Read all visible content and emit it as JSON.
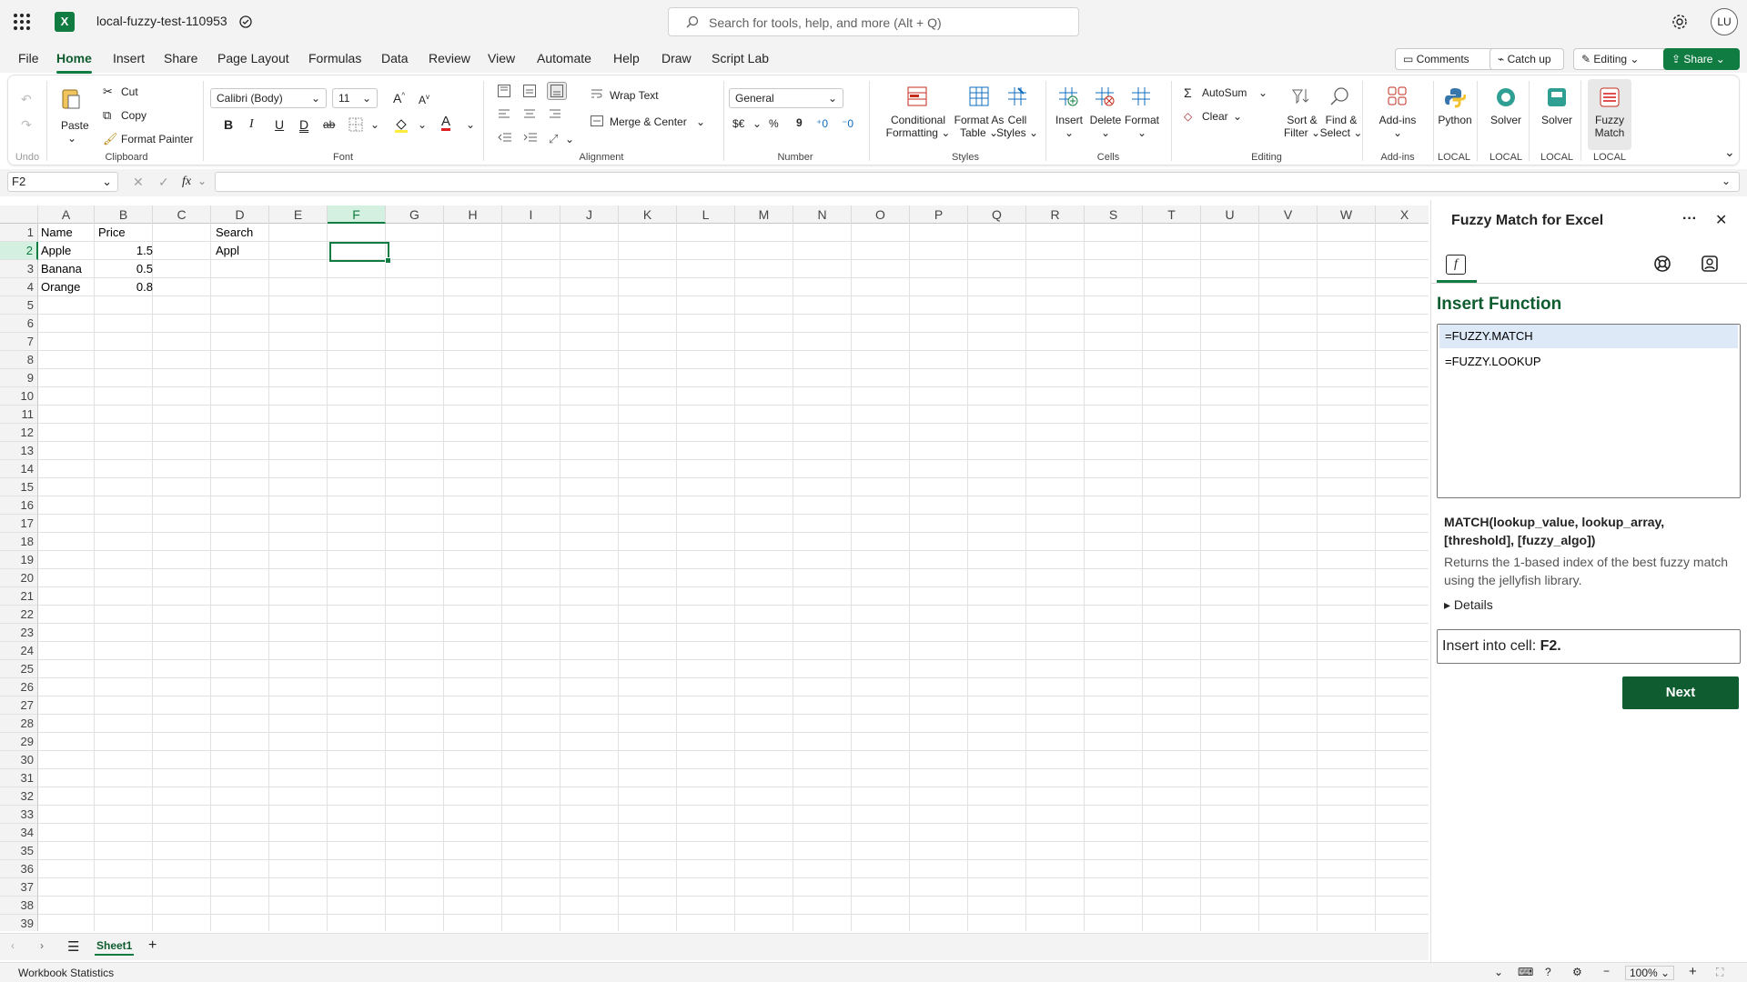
{
  "app": {
    "doc_name": "local-fuzzy-test-110953",
    "avatar_initials": "LU",
    "accent": "#107c41"
  },
  "search": {
    "placeholder": "Search for tools, help, and more (Alt + Q)"
  },
  "menu_tabs": [
    "File",
    "Home",
    "Insert",
    "Share",
    "Page Layout",
    "Formulas",
    "Data",
    "Review",
    "View",
    "Automate",
    "Help",
    "Draw",
    "Script Lab"
  ],
  "top_buttons": {
    "comments": "Comments",
    "catch_up": "Catch up",
    "editing": "Editing",
    "share": "Share"
  },
  "ribbon": {
    "undo_group": "Undo",
    "clipboard": {
      "paste": "Paste",
      "cut": "Cut",
      "copy": "Copy",
      "format_painter": "Format Painter",
      "group": "Clipboard"
    },
    "font": {
      "family": "Calibri (Body)",
      "size": "11",
      "group": "Font",
      "bold": "B",
      "italic": "I",
      "underline": "U",
      "dunderline": "D",
      "strike": "ab",
      "color_a": "A",
      "grow": "A",
      "shrink": "A"
    },
    "alignment": {
      "wrap": "Wrap Text",
      "merge": "Merge & Center",
      "group": "Alignment"
    },
    "number": {
      "format": "General",
      "currency": "$€",
      "percent": "%",
      "comma": "9",
      "group": "Number"
    },
    "styles": {
      "conditional1": "Conditional",
      "conditional2": "Formatting",
      "table1": "Format As",
      "table2": "Table",
      "cell1": "Cell",
      "cell2": "Styles",
      "group": "Styles"
    },
    "cells": {
      "insert": "Insert",
      "delete": "Delete",
      "format": "Format",
      "group": "Cells"
    },
    "editing": {
      "autosum": "AutoSum",
      "clear": "Clear",
      "sort1": "Sort &",
      "sort2": "Filter",
      "find1": "Find &",
      "find2": "Select",
      "group": "Editing"
    },
    "addins": {
      "label": "Add-ins",
      "group": "Add-ins"
    },
    "python": {
      "label": "Python",
      "group": "LOCAL"
    },
    "solver1": {
      "label": "Solver",
      "group": "LOCAL"
    },
    "solver2": {
      "label": "Solver",
      "group": "LOCAL"
    },
    "fuzzy": {
      "label1": "Fuzzy",
      "label2": "Match",
      "group": "LOCAL"
    }
  },
  "formula_bar": {
    "name_box": "F2",
    "fx": "fx",
    "value": ""
  },
  "columns": [
    "A",
    "B",
    "C",
    "D",
    "E",
    "F",
    "G",
    "H",
    "I",
    "J",
    "K",
    "L",
    "M",
    "N",
    "O",
    "P",
    "Q",
    "R",
    "S",
    "T",
    "U",
    "V",
    "W",
    "X"
  ],
  "selected_column": "F",
  "selected_row": 2,
  "rows": [
    "1",
    "2",
    "3",
    "4",
    "5",
    "6",
    "7",
    "8",
    "9",
    "10",
    "11",
    "12",
    "13",
    "14",
    "15",
    "16",
    "17",
    "18",
    "19",
    "20",
    "21",
    "22",
    "23",
    "24",
    "25",
    "26",
    "27",
    "28",
    "29",
    "30",
    "31",
    "32",
    "33",
    "34",
    "35",
    "36",
    "37",
    "38",
    "39"
  ],
  "cells": {
    "a1": "Name",
    "b1": "Price",
    "d1": "Search",
    "a2": "Apple",
    "b2": "1.5",
    "d2": "Appl",
    "a3": "Banana",
    "b3": "0.5",
    "a4": "Orange",
    "b4": "0.8"
  },
  "sheet_tabs": {
    "active": "Sheet1"
  },
  "status": {
    "left": "Workbook Statistics",
    "zoom": "100%"
  },
  "pane": {
    "title": "Fuzzy Match for Excel",
    "heading": "Insert Function",
    "functions": [
      "=FUZZY.MATCH",
      "=FUZZY.LOOKUP"
    ],
    "signature": "MATCH(lookup_value, lookup_array, [threshold], [fuzzy_algo])",
    "description": "Returns the 1-based index of the best fuzzy match using the jellyfish library.",
    "details": "Details",
    "insert_label": "Insert into cell:",
    "insert_cell": "F2.",
    "next": "Next"
  }
}
